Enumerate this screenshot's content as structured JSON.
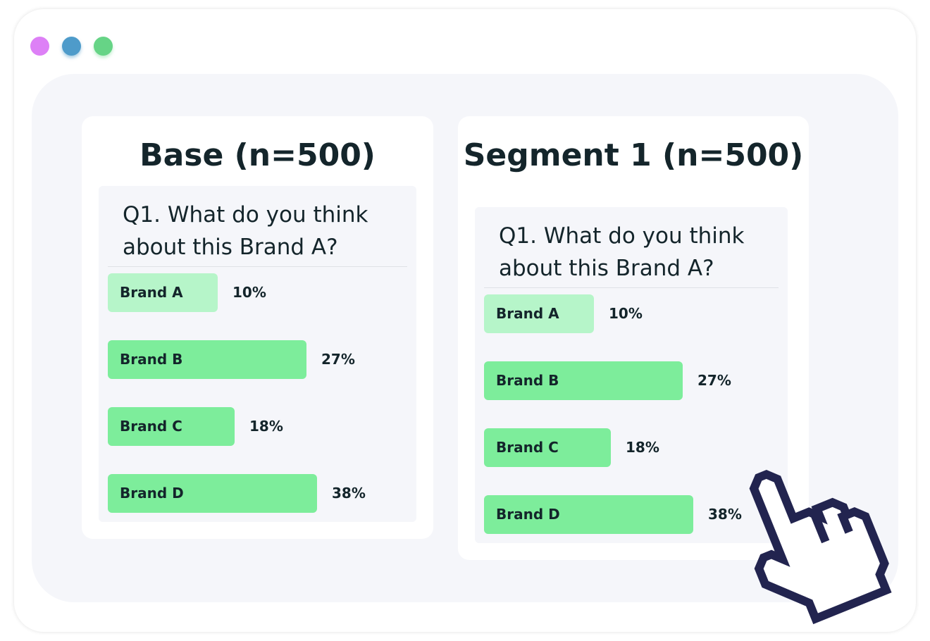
{
  "window": {
    "dots": [
      {
        "color": "#dd80f6"
      },
      {
        "color": "#4e9bca"
      },
      {
        "color": "#66d486"
      }
    ]
  },
  "colors": {
    "bar": "#7ded9b",
    "bar_highlight": "#b6f5c9",
    "text": "#14252b",
    "cursor": "#22244f"
  },
  "chart_data": [
    {
      "type": "bar",
      "orientation": "horizontal",
      "title": "Base (n=500)",
      "question": "Q1. What do you think about this Brand A?",
      "categories": [
        "Brand A",
        "Brand B",
        "Brand C",
        "Brand D"
      ],
      "values": [
        10,
        27,
        18,
        38
      ],
      "labels": [
        "10%",
        "27%",
        "18%",
        "38%"
      ]
    },
    {
      "type": "bar",
      "orientation": "horizontal",
      "title": "Segment 1 (n=500)",
      "question": "Q1. What do you think about this Brand A?",
      "categories": [
        "Brand A",
        "Brand B",
        "Brand C",
        "Brand D"
      ],
      "values": [
        10,
        27,
        18,
        38
      ],
      "labels": [
        "10%",
        "27%",
        "18%",
        "38%"
      ]
    }
  ],
  "cursor": {
    "icon": "pointer-hand-icon"
  }
}
